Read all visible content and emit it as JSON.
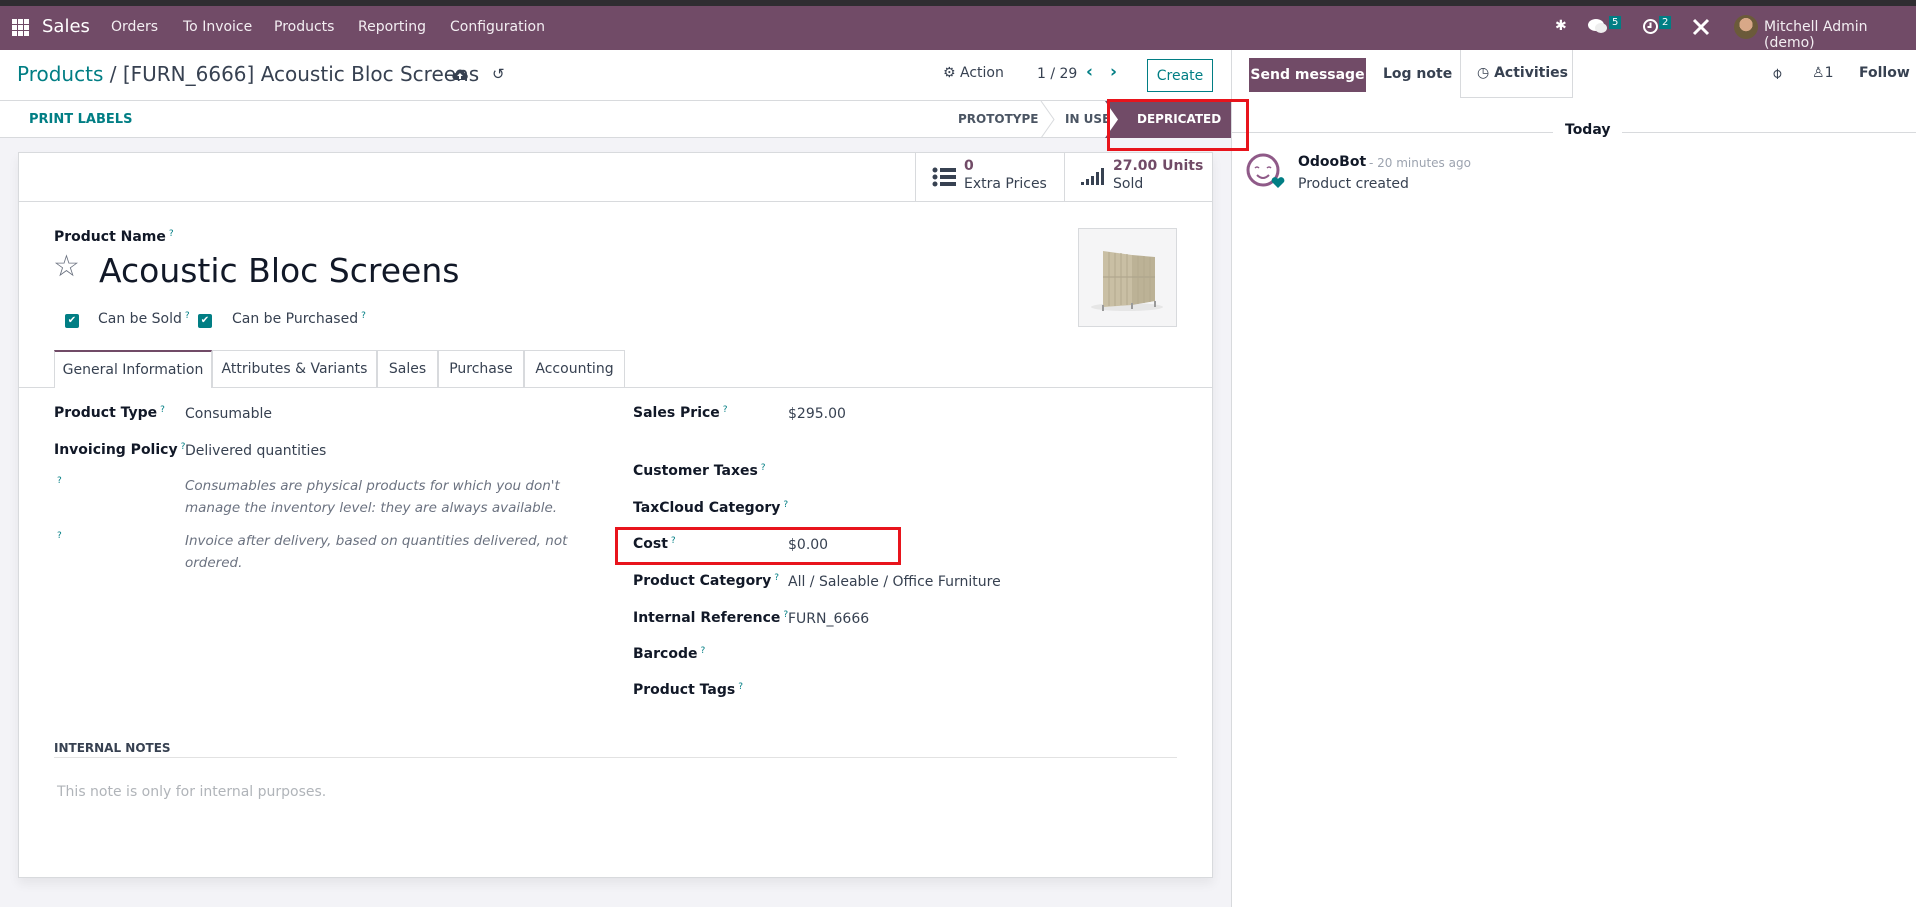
{
  "navbar": {
    "app_name": "Sales",
    "menu": [
      "Orders",
      "To Invoice",
      "Products",
      "Reporting",
      "Configuration"
    ],
    "icons": [
      "debug-bug-icon",
      "messages-icon",
      "activities-clock-icon",
      "tools-icon"
    ],
    "messages_count": "5",
    "activities_count": "2",
    "user_name": "Mitchell Admin (demo)"
  },
  "control_panel": {
    "breadcrumb_parent": "Products",
    "breadcrumb_separator": "/",
    "breadcrumb_current": "[FURN_6666] Acoustic Bloc Screens",
    "action_label": "Action",
    "pager": "1 / 29",
    "create_label": "Create"
  },
  "status_bar": {
    "print_labels": "PRINT LABELS",
    "stages": [
      "PROTOTYPE",
      "IN USE",
      "DEPRICATED"
    ],
    "active_stage": "DEPRICATED"
  },
  "stat_buttons": [
    {
      "value": "0",
      "label": "Extra Prices"
    },
    {
      "value": "27.00 Units",
      "label": "Sold"
    }
  ],
  "form": {
    "product_name_label": "Product Name",
    "product_name": "Acoustic Bloc Screens",
    "can_be_sold_label": "Can be Sold",
    "can_be_sold": true,
    "can_be_purchased_label": "Can be Purchased",
    "can_be_purchased": true,
    "help_mark": "?",
    "tabs": [
      "General Information",
      "Attributes & Variants",
      "Sales",
      "Purchase",
      "Accounting"
    ],
    "active_tab": "General Information",
    "left_fields": [
      {
        "label": "Product Type",
        "value": "Consumable"
      },
      {
        "label": "Invoicing Policy",
        "value": "Delivered quantities"
      }
    ],
    "hints": [
      "Consumables are physical products for which you don't manage the inventory level: they are always available.",
      "Invoice after delivery, based on quantities delivered, not ordered."
    ],
    "right_fields": [
      {
        "label": "Sales Price",
        "value": "$295.00"
      },
      {
        "label": "Customer Taxes",
        "value": ""
      },
      {
        "label": "TaxCloud Category",
        "value": ""
      },
      {
        "label": "Cost",
        "value": "$0.00"
      },
      {
        "label": "Product Category",
        "value": "All / Saleable / Office Furniture"
      },
      {
        "label": "Internal Reference",
        "value": "FURN_6666"
      },
      {
        "label": "Barcode",
        "value": ""
      },
      {
        "label": "Product Tags",
        "value": ""
      }
    ],
    "internal_notes_title": "INTERNAL NOTES",
    "internal_notes_placeholder": "This note is only for internal purposes."
  },
  "chatter": {
    "send_message": "Send message",
    "log_note": "Log note",
    "activities": "Activities",
    "followers_count": "1",
    "follow": "Follow",
    "date_separator": "Today",
    "messages": [
      {
        "author": "OdooBot",
        "time": "- 20 minutes ago",
        "body": "Product created"
      }
    ]
  },
  "colors": {
    "brand": "#714b67",
    "accent": "#017e84",
    "highlight": "#e8141c"
  }
}
